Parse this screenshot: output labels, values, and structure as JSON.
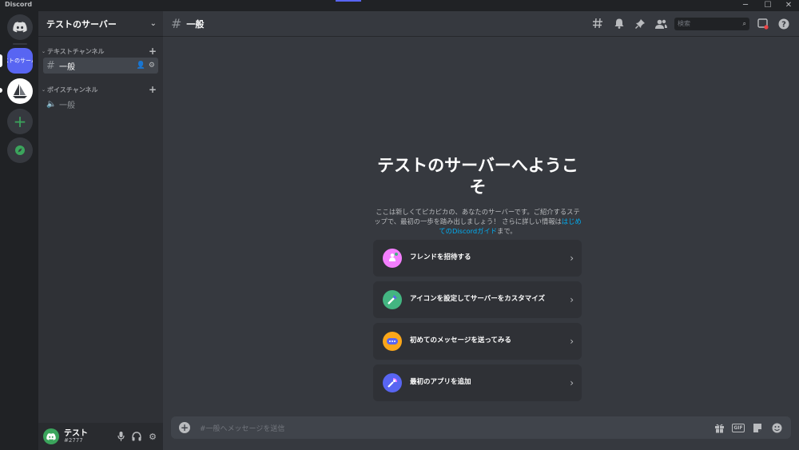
{
  "app": {
    "brand": "Discord"
  },
  "guilds": {
    "test_server_label": "ストのサーバ"
  },
  "server": {
    "name": "テストのサーバー"
  },
  "categories": {
    "text": "テキストチャンネル",
    "voice": "ボイスチャンネル"
  },
  "channels": {
    "text_general": "一般",
    "voice_general": "一般"
  },
  "header": {
    "channel_name": "一般",
    "search_placeholder": "検索"
  },
  "welcome": {
    "title": "テストのサーバーへようこそ",
    "desc_pre": "ここは新しくてピカピカの、あなたのサーバーです。ご紹介するステップで、最初の一歩を踏み出しましょう！ さらに詳しい情報は",
    "desc_link": "はじめてのDiscordガイド",
    "desc_post": "まで。"
  },
  "cards": [
    {
      "label": "フレンドを招待する",
      "color": "#f47fff"
    },
    {
      "label": "アイコンを設定してサーバーをカスタマイズ",
      "color": "#43b581"
    },
    {
      "label": "初めてのメッセージを送ってみる",
      "color": "#faa61a"
    },
    {
      "label": "最初のアプリを追加",
      "color": "#5865f2"
    }
  ],
  "composer": {
    "placeholder": "#一般へメッセージを送信",
    "gif_label": "GIF"
  },
  "user": {
    "name": "テスト",
    "tag": "#2777"
  },
  "colors": {
    "blurple": "#5865f2",
    "green": "#3ba55c",
    "link": "#00aff4"
  }
}
